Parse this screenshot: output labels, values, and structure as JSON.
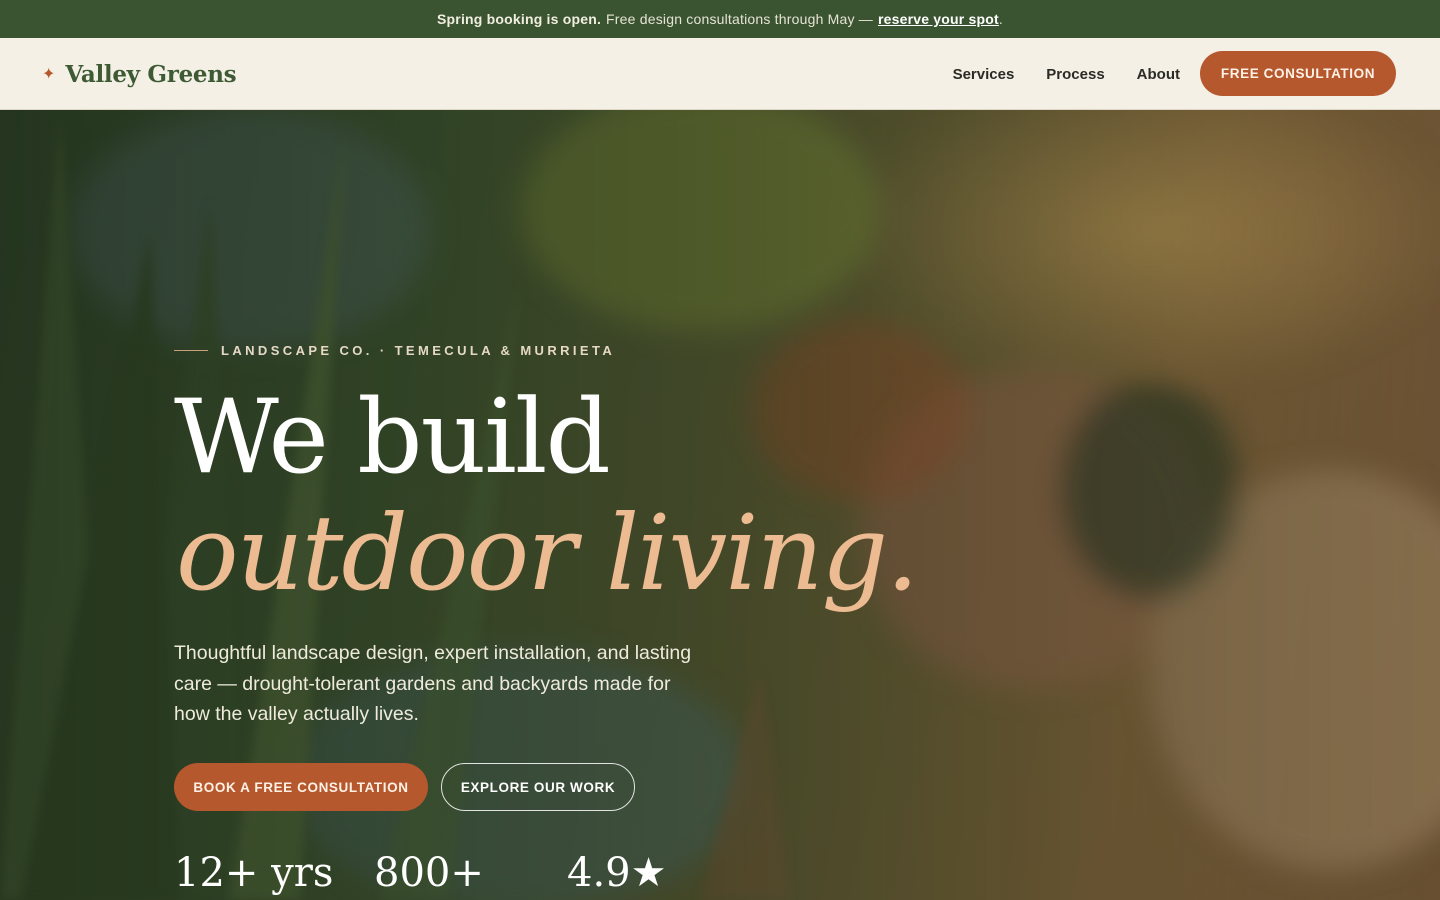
{
  "announcement": {
    "strong": "Spring booking is open.",
    "text": "Free design consultations through May —",
    "link": "reserve your spot",
    "tail": "."
  },
  "nav": {
    "logo_icon": "sparkle-icon",
    "brand": "Valley Greens",
    "links": [
      "Services",
      "Process",
      "About"
    ],
    "cta": "FREE CONSULTATION"
  },
  "hero": {
    "eyebrow": "LANDSCAPE CO. · TEMECULA & MURRIETA",
    "headline_line1": "We build",
    "headline_line2": "outdoor living.",
    "lede": "Thoughtful landscape design, expert installation, and lasting care — drought-tolerant gardens and backyards made for how the valley actually lives.",
    "primary_cta": "BOOK A FREE CONSULTATION",
    "secondary_cta": "EXPLORE OUR WORK",
    "stats": [
      "12+ yrs",
      "800+",
      "4.9★"
    ]
  },
  "colors": {
    "announcement_bg": "#3a5431",
    "nav_bg": "#f4f0e6",
    "brand_green": "#3d5a34",
    "accent": "#b5582d",
    "headline_accent": "#edbb92"
  }
}
